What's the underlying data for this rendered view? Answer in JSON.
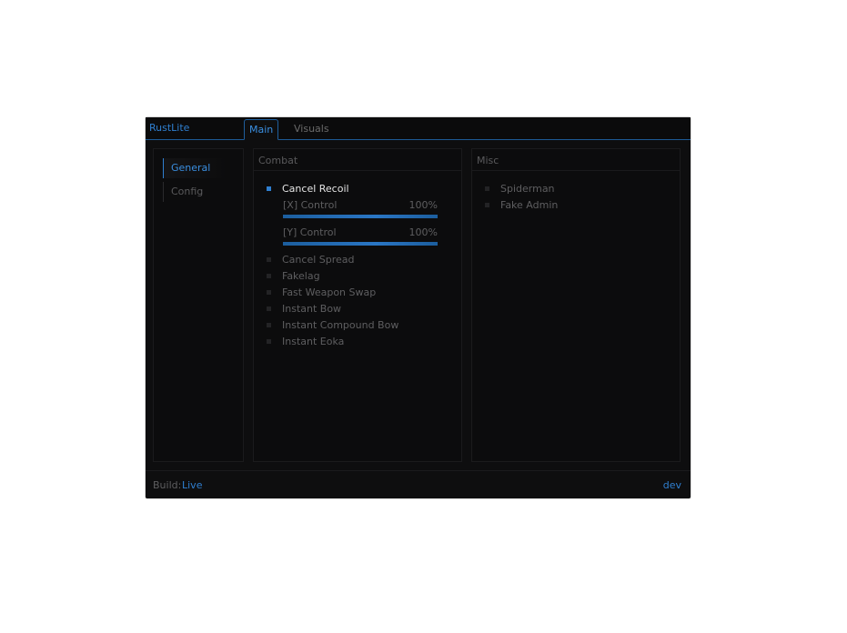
{
  "app": {
    "title": "RustLite"
  },
  "tabs": [
    {
      "label": "Main",
      "active": true
    },
    {
      "label": "Visuals",
      "active": false
    }
  ],
  "sidebar": {
    "items": [
      {
        "label": "General",
        "active": true
      },
      {
        "label": "Config",
        "active": false
      }
    ]
  },
  "combat": {
    "title": "Combat",
    "options": [
      {
        "label": "Cancel Recoil",
        "checked": true
      },
      {
        "label": "Cancel Spread",
        "checked": false
      },
      {
        "label": "Fakelag",
        "checked": false
      },
      {
        "label": "Fast Weapon Swap",
        "checked": false
      },
      {
        "label": "Instant Bow",
        "checked": false
      },
      {
        "label": "Instant Compound Bow",
        "checked": false
      },
      {
        "label": "Instant Eoka",
        "checked": false
      }
    ],
    "sliders": [
      {
        "label": "[X] Control",
        "value": "100%",
        "fraction": 1.0
      },
      {
        "label": "[Y] Control",
        "value": "100%",
        "fraction": 1.0
      }
    ]
  },
  "misc": {
    "title": "Misc",
    "options": [
      {
        "label": "Spiderman",
        "checked": false
      },
      {
        "label": "Fake Admin",
        "checked": false
      }
    ]
  },
  "footer": {
    "build_label": "Build:",
    "build_value": "Live",
    "right_text": "dev"
  },
  "colors": {
    "accent": "#2f7fd0",
    "background": "#0e0e0f"
  }
}
